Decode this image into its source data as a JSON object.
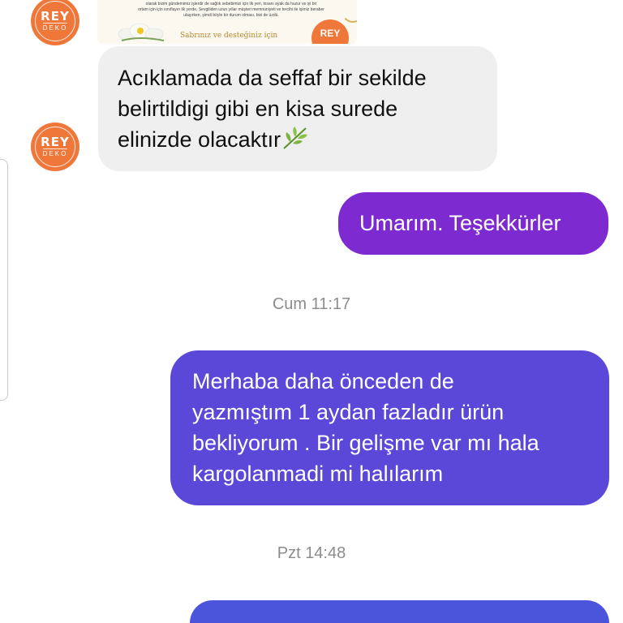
{
  "colors": {
    "brand_orange": "#f0773a",
    "incoming_bg": "#efefef",
    "outgoing_purple": "#7d2ad0",
    "outgoing_indigo": "#5845d6",
    "outgoing_blue": "#4a55dc",
    "timestamp": "#8c8c8c"
  },
  "avatar": {
    "brand": "REY",
    "sub": "DEKO"
  },
  "shared_image": {
    "text_line_1": "olarak bizim gündemimiz işlerdir de sağlık sebebimizi için ilk yeri, insanı ayak da huzur ve iyi bir",
    "text_line_2": "ortam için için sınıflayın ilk yerde, Sevgiliden uzun yıllar müşteri memnuniyeti ve tercihi ile işimiz beraber",
    "text_line_3": "ulaşırken, şimdi böyle bir durum olması, bizi de üzdü.",
    "caption": "Sabrınız ve desteğiniz için",
    "logo_text": "REY"
  },
  "messages": [
    {
      "direction": "incoming",
      "lines": [
        "Acıklamada da seffaf bir sekilde",
        "belirtildigi gibi en kisa surede",
        "elinizde olacaktır"
      ],
      "emoji": "herb-icon"
    },
    {
      "direction": "outgoing",
      "lines": [
        "Umarım. Teşekkürler"
      ]
    },
    {
      "direction": "timestamp",
      "text": "Cum 11:17"
    },
    {
      "direction": "outgoing",
      "lines": [
        "Merhaba daha önceden de",
        "yazmıştım 1 aydan fazladır ürün",
        "bekliyorum . Bir gelişme var mı hala",
        "kargolanmadi mi halılarım"
      ]
    },
    {
      "direction": "timestamp",
      "text": "Pzt 14:48"
    },
    {
      "direction": "outgoing",
      "lines": [
        ""
      ]
    }
  ]
}
